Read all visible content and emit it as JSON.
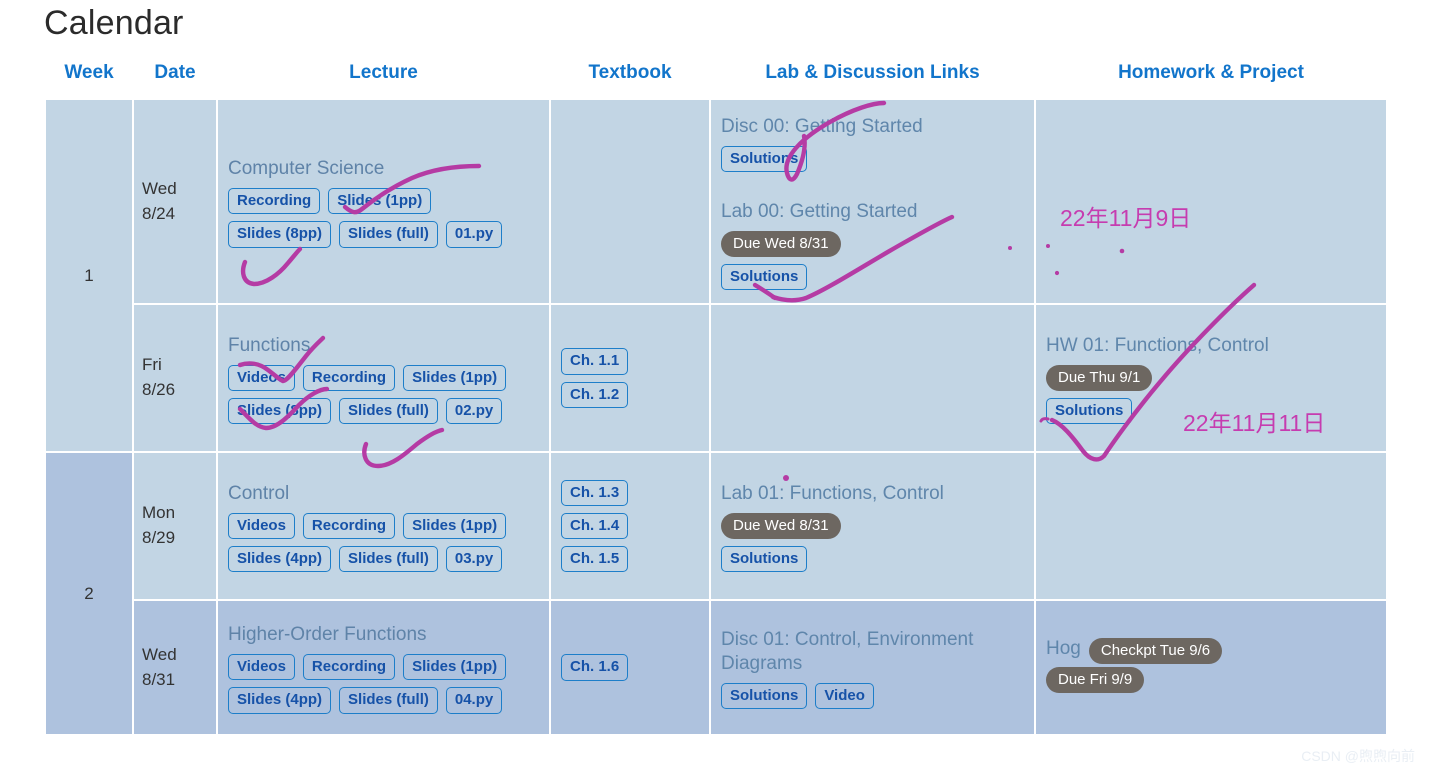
{
  "page": {
    "title": "Calendar",
    "watermark": "CSDN @煦煦向前"
  },
  "table": {
    "headers": {
      "week": "Week",
      "date": "Date",
      "lecture": "Lecture",
      "textbook": "Textbook",
      "lab": "Lab & Discussion Links",
      "homework": "Homework & Project"
    },
    "rows": [
      {
        "week": "1",
        "week_rowspan": 2,
        "shade": "light",
        "date": {
          "day": "Wed",
          "date": "8/24"
        },
        "lecture": {
          "title": "Computer Science",
          "chips": [
            "Recording",
            "Slides (1pp)",
            "Slides (8pp)",
            "Slides (full)",
            "01.py"
          ]
        },
        "textbook": {
          "chips": []
        },
        "lab": [
          {
            "title": "Disc 00: Getting Started",
            "badges": [],
            "chips": [
              "Solutions"
            ]
          },
          {
            "title": "Lab 00: Getting Started",
            "badges": [
              "Due Wed 8/31"
            ],
            "chips": [
              "Solutions"
            ]
          }
        ],
        "homework": []
      },
      {
        "week": null,
        "shade": "light",
        "date": {
          "day": "Fri",
          "date": "8/26"
        },
        "lecture": {
          "title": "Functions",
          "chips": [
            "Videos",
            "Recording",
            "Slides (1pp)",
            "Slides (8pp)",
            "Slides (full)",
            "02.py"
          ]
        },
        "textbook": {
          "chips": [
            "Ch. 1.1",
            "Ch. 1.2"
          ]
        },
        "lab": [],
        "homework": [
          {
            "title": "HW 01: Functions, Control",
            "badges": [
              "Due Thu 9/1"
            ],
            "chips": [
              "Solutions"
            ]
          }
        ]
      },
      {
        "week": "2",
        "week_rowspan": 2,
        "week_shade": "dark",
        "shade": "light",
        "date": {
          "day": "Mon",
          "date": "8/29"
        },
        "lecture": {
          "title": "Control",
          "chips": [
            "Videos",
            "Recording",
            "Slides (1pp)",
            "Slides (4pp)",
            "Slides (full)",
            "03.py"
          ]
        },
        "textbook": {
          "chips": [
            "Ch. 1.3",
            "Ch. 1.4",
            "Ch. 1.5"
          ]
        },
        "lab": [
          {
            "title": "Lab 01: Functions, Control",
            "badges": [
              "Due Wed 8/31"
            ],
            "chips": [
              "Solutions"
            ]
          }
        ],
        "homework": []
      },
      {
        "week": null,
        "shade": "dark",
        "date": {
          "day": "Wed",
          "date": "8/31"
        },
        "lecture": {
          "title": "Higher-Order Functions",
          "chips": [
            "Videos",
            "Recording",
            "Slides (1pp)",
            "Slides (4pp)",
            "Slides (full)",
            "04.py"
          ]
        },
        "textbook": {
          "chips": [
            "Ch. 1.6"
          ]
        },
        "lab": [
          {
            "title": "Disc 01: Control, Environment Diagrams",
            "badges": [],
            "chips": [
              "Solutions",
              "Video"
            ]
          }
        ],
        "homework": [
          {
            "title": "Hog",
            "inline_badges": [
              "Checkpt Tue 9/6"
            ],
            "badges": [
              "Due Fri 9/9"
            ],
            "chips": []
          }
        ]
      }
    ]
  },
  "annotations": {
    "date_note_1": "22年11月9日",
    "date_note_2": "22年11月11日",
    "ink_color": "#c63cb0"
  },
  "colors": {
    "header_link": "#1275cb",
    "chip_border": "#1d7ec9",
    "chip_text": "#1652a8",
    "row_light": "#c2d5e4",
    "row_dark": "#aec2de",
    "badge_bg": "#6d6761",
    "title_text": "#5f83a8"
  }
}
